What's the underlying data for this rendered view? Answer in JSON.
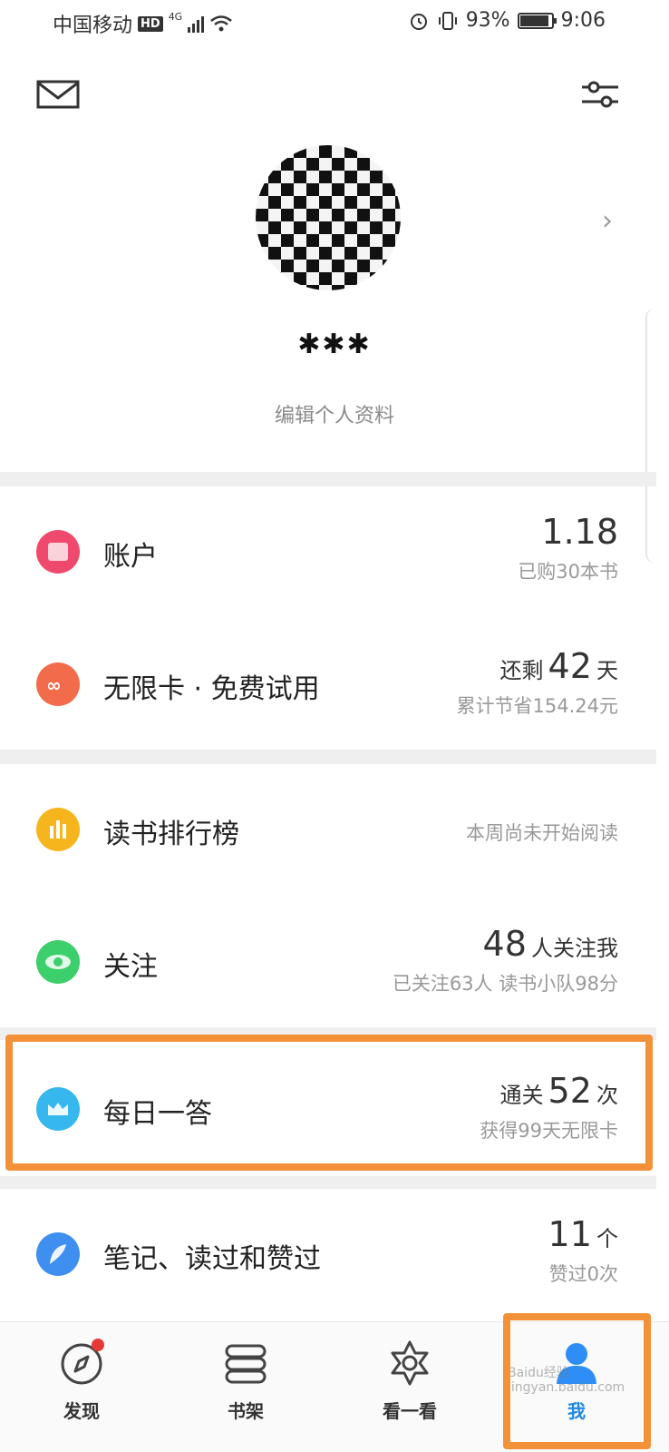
{
  "status_bar": {
    "carrier": "中国移动",
    "hd": "HD",
    "network": "4G",
    "battery": "93%",
    "battery_level": 0.93,
    "time": "9:06"
  },
  "header": {
    "mail_icon": "mail-icon",
    "settings_icon": "settings-sliders-icon"
  },
  "profile": {
    "username": "✱✱✱",
    "edit_label": "编辑个人资料"
  },
  "account": {
    "label": "账户",
    "value": "1.18",
    "sub": "已购30本书",
    "color": "#ef4a6d"
  },
  "unlimited": {
    "label": "无限卡 · 免费试用",
    "prefix": "还剩",
    "value": "42",
    "unit": "天",
    "sub": "累计节省154.24元",
    "color": "#f26b4b"
  },
  "ranking": {
    "label": "读书排行榜",
    "sub": "本周尚未开始阅读",
    "color": "#f7b51d"
  },
  "follow": {
    "label": "关注",
    "value": "48",
    "unit": "人关注我",
    "sub": "已关注63人 读书小队98分",
    "color": "#3ccf6b"
  },
  "daily_quiz": {
    "label": "每日一答",
    "prefix": "通关",
    "value": "52",
    "unit": "次",
    "sub": "获得99天无限卡",
    "color": "#36b7ee"
  },
  "notes": {
    "label": "笔记、读过和赞过",
    "value": "11",
    "unit": "个",
    "sub": "赞过0次",
    "color": "#3f8ff0"
  },
  "tabs": [
    {
      "label": "发现",
      "icon": "compass-icon"
    },
    {
      "label": "书架",
      "icon": "bookshelf-icon"
    },
    {
      "label": "看一看",
      "icon": "star-outline-icon"
    },
    {
      "label": "我",
      "icon": "person-icon"
    }
  ],
  "watermark": "Baidu经验 jingyan.baidu.com"
}
